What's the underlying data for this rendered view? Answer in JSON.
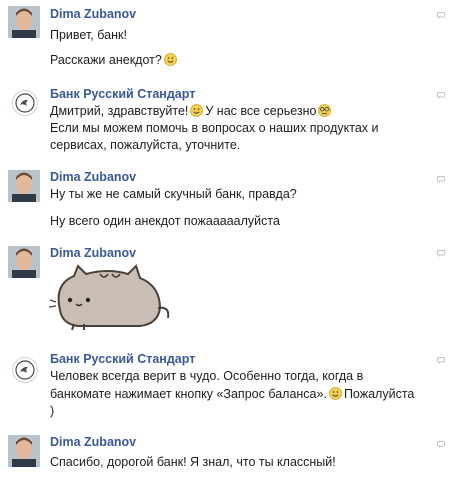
{
  "conversation": {
    "messages": [
      {
        "sender": "Dima Zubanov",
        "lines": [
          "Привет, банк!",
          "Расскажи анекдот?"
        ]
      },
      {
        "sender": "Банк Русский Стандарт",
        "lines": [
          "Дмитрий, здравствуйте!",
          "У нас все серьезно",
          "Если мы можем помочь в вопросах о наших продуктах и",
          "сервисах, пожалуйста, уточните."
        ]
      },
      {
        "sender": "Dima Zubanov",
        "lines": [
          "Ну ты же не самый скучный банк, правда?",
          "Ну всего один анекдот пожааааалуйста"
        ]
      },
      {
        "sender": "Dima Zubanov",
        "sticker": "pusheen-cat-sticker"
      },
      {
        "sender": "Банк Русский Стандарт",
        "lines": [
          "Человек всегда верит в чудо. Особенно тогда, когда в",
          "банкомате нажимает кнопку «Запрос баланса».",
          "Пожалуйста",
          ")"
        ]
      },
      {
        "sender": "Dima Zubanov",
        "lines": [
          "Спасибо, дорогой банк! Я знал, что ты классный!"
        ]
      }
    ]
  },
  "colors": {
    "name_link": "#3b5998",
    "text": "#1c1e21",
    "emoji": "#f5d04c"
  }
}
